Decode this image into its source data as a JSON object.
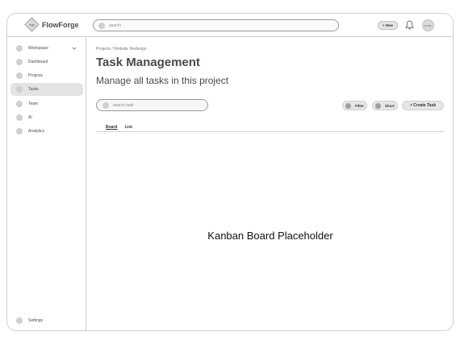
{
  "header": {
    "logo_text": "logo",
    "brand": "FlowForge",
    "search_placeholder": "search",
    "new_label": "+ New",
    "profile_label": "Profile"
  },
  "sidebar": {
    "items": [
      {
        "label": "Workspace"
      },
      {
        "label": "Dashboard"
      },
      {
        "label": "Projects"
      },
      {
        "label": "Tasks"
      },
      {
        "label": "Team"
      },
      {
        "label": "AI"
      },
      {
        "label": "Analytics"
      }
    ],
    "settings_label": "Settings"
  },
  "main": {
    "breadcrumb": "Projects / Website Redesign",
    "title": "Task Management",
    "subtitle": "Manage all tasks in this project",
    "search_placeholder": "search task",
    "filter_label": "Filter",
    "short_label": "Short",
    "create_label": "+ Create Task",
    "tabs": [
      {
        "label": "Board"
      },
      {
        "label": "List"
      }
    ],
    "placeholder": "Kanban Board Placeholder"
  },
  "colors": {
    "frame_border": "#cfcfcf",
    "active_bg": "#e3e3e3",
    "button_bg": "#e6e6e6"
  },
  "icons": [
    "logo-diamond-icon",
    "search-icon",
    "bell-icon",
    "chevron-down-icon"
  ]
}
